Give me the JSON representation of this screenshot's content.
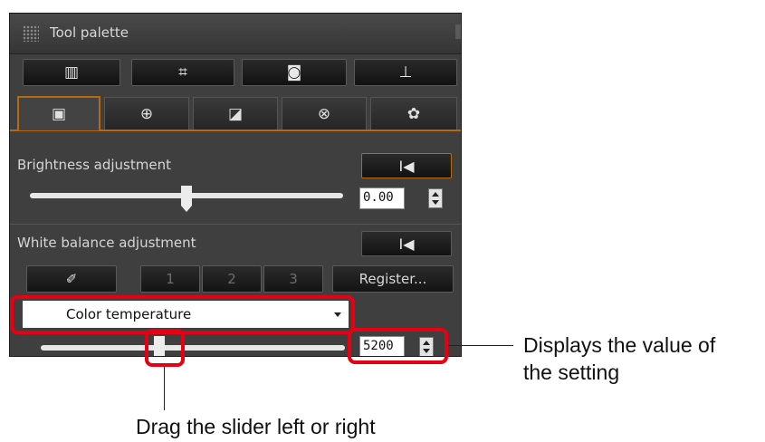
{
  "panel": {
    "title": "Tool palette",
    "toolbar": [
      {
        "icon": "rgb-image-adjust-icon",
        "glyph": "▥"
      },
      {
        "icon": "crop-icon",
        "glyph": "⌗"
      },
      {
        "icon": "dust-delete-icon",
        "glyph": "◙"
      },
      {
        "icon": "stamp-icon",
        "glyph": "⊥"
      }
    ],
    "tabs": [
      {
        "icon": "basic-adjust-icon",
        "glyph": "▣"
      },
      {
        "icon": "noise-reduction-icon",
        "glyph": "⊕"
      },
      {
        "icon": "tone-curve-icon",
        "glyph": "◪"
      },
      {
        "icon": "color-adjust-icon",
        "glyph": "⊗"
      },
      {
        "icon": "settings-gear-icon",
        "glyph": "✿"
      }
    ],
    "brightness": {
      "label": "Brightness adjustment",
      "value": "0.00",
      "slider_fraction": 0.5,
      "reset_glyph": "I◀"
    },
    "white_balance": {
      "label": "White balance adjustment",
      "reset_glyph": "I◀",
      "eyedropper_glyph": "✐",
      "presets": [
        "1",
        "2",
        "3"
      ],
      "register_label": "Register...",
      "mode": "Color temperature",
      "value": "5200",
      "slider_fraction": 0.39
    }
  },
  "callouts": {
    "value_text_line1": "Displays the value of",
    "value_text_line2": "the setting",
    "slider_text": "Drag the slider left or right"
  },
  "colors": {
    "highlight_red": "#e60012",
    "accent_orange": "#b36a12",
    "panel_bg": "#3f3f3f"
  }
}
